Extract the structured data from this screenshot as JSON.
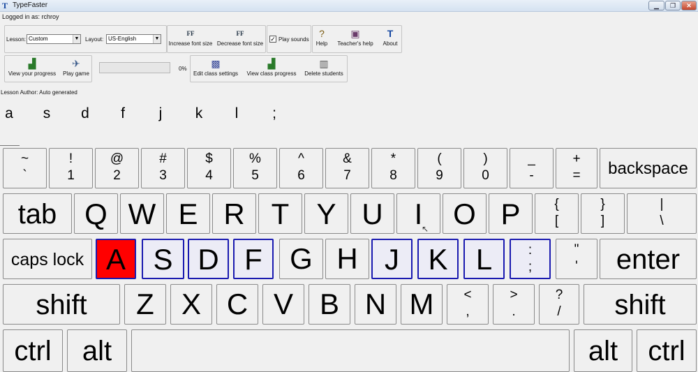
{
  "window": {
    "title": "TypeFaster",
    "minimize": "▁",
    "restore": "❐",
    "close": "✕"
  },
  "status": {
    "logged_in": "Logged in as: rchroy"
  },
  "toolbar1": {
    "lesson_label": "Lesson:",
    "lesson_value": "Custom",
    "layout_label": "Layout:",
    "layout_value": "US-English",
    "increase_font": "Increase font size",
    "decrease_font": "Decrease font size",
    "play_sounds": "Play sounds",
    "play_sounds_checked": true,
    "help": "Help",
    "teachers_help": "Teacher's help",
    "about": "About",
    "increase_icon": "FF",
    "decrease_icon": "FF"
  },
  "toolbar2": {
    "view_progress": "View your progress",
    "play_game": "Play game",
    "progress_value": "0%",
    "edit_class": "Edit class settings",
    "view_class": "View class progress",
    "delete_students": "Delete students"
  },
  "lesson": {
    "author": "Lesson Author: Auto generated",
    "keys": [
      "a",
      "s",
      "d",
      "f",
      "j",
      "k",
      "l",
      ";"
    ]
  },
  "keyboard": {
    "row1": [
      {
        "t": "~",
        "b": "`"
      },
      {
        "t": "!",
        "b": "1"
      },
      {
        "t": "@",
        "b": "2"
      },
      {
        "t": "#",
        "b": "3"
      },
      {
        "t": "$",
        "b": "4"
      },
      {
        "t": "%",
        "b": "5"
      },
      {
        "t": "^",
        "b": "6"
      },
      {
        "t": "&",
        "b": "7"
      },
      {
        "t": "*",
        "b": "8"
      },
      {
        "t": "(",
        "b": "9"
      },
      {
        "t": ")",
        "b": "0"
      },
      {
        "t": "_",
        "b": "-"
      },
      {
        "t": "+",
        "b": "="
      }
    ],
    "backspace": "backspace",
    "tab": "tab",
    "row2": [
      "Q",
      "W",
      "E",
      "R",
      "T",
      "Y",
      "U",
      "I",
      "O",
      "P"
    ],
    "row2_sym": [
      {
        "t": "{",
        "b": "["
      },
      {
        "t": "}",
        "b": "]"
      },
      {
        "t": "|",
        "b": "\\"
      }
    ],
    "caps_lock": "caps lock",
    "row3": [
      "A",
      "S",
      "D",
      "F",
      "G",
      "H",
      "J",
      "K",
      "L"
    ],
    "row3_sym": [
      {
        "t": ":",
        "b": ";"
      },
      {
        "t": "\"",
        "b": "'"
      }
    ],
    "enter": "enter",
    "shift": "shift",
    "row4": [
      "Z",
      "X",
      "C",
      "V",
      "B",
      "N",
      "M"
    ],
    "row4_sym": [
      {
        "t": "<",
        "b": ","
      },
      {
        "t": ">",
        "b": "."
      },
      {
        "t": "?",
        "b": "/"
      }
    ],
    "ctrl": "ctrl",
    "alt": "alt",
    "space": "",
    "active_key": "A",
    "home_keys": [
      "S",
      "D",
      "F",
      "J",
      "K",
      "L",
      ";"
    ],
    "colors": {
      "active": "#ff0000",
      "home_border": "#1a1ab0"
    }
  }
}
